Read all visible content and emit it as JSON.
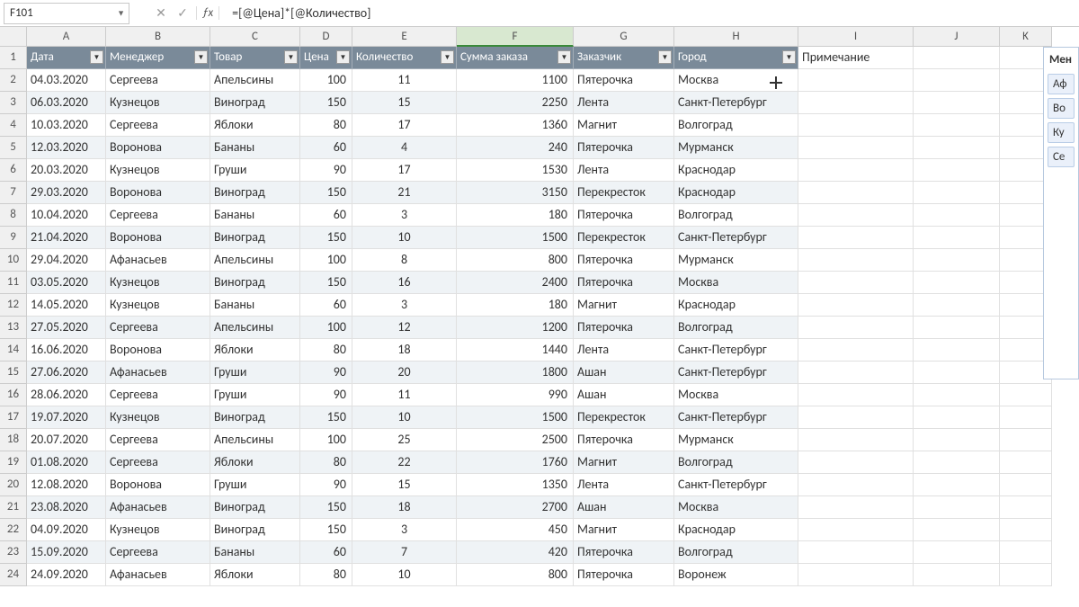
{
  "formula_bar": {
    "cell_ref": "F101",
    "formula": "=[@Цена]*[@Количество]"
  },
  "cols": [
    "A",
    "B",
    "C",
    "D",
    "E",
    "F",
    "G",
    "H",
    "I",
    "J",
    "K"
  ],
  "headers": {
    "A": "Дата",
    "B": "Менеджер",
    "C": "Товар",
    "D": "Цена",
    "E": "Количество",
    "F": "Сумма заказа",
    "G": "Заказчик",
    "H": "Город",
    "I_label": "Примечание"
  },
  "rows": [
    {
      "n": 2,
      "A": "04.03.2020",
      "B": "Сергеева",
      "C": "Апельсины",
      "D": 100,
      "E": 11,
      "F": 1100,
      "G": "Пятерочка",
      "H": "Москва"
    },
    {
      "n": 3,
      "A": "06.03.2020",
      "B": "Кузнецов",
      "C": "Виноград",
      "D": 150,
      "E": 15,
      "F": 2250,
      "G": "Лента",
      "H": "Санкт-Петербург"
    },
    {
      "n": 4,
      "A": "10.03.2020",
      "B": "Сергеева",
      "C": "Яблоки",
      "D": 80,
      "E": 17,
      "F": 1360,
      "G": "Магнит",
      "H": "Волгоград"
    },
    {
      "n": 5,
      "A": "12.03.2020",
      "B": "Воронова",
      "C": "Бананы",
      "D": 60,
      "E": 4,
      "F": 240,
      "G": "Пятерочка",
      "H": "Мурманск"
    },
    {
      "n": 6,
      "A": "20.03.2020",
      "B": "Кузнецов",
      "C": "Груши",
      "D": 90,
      "E": 17,
      "F": 1530,
      "G": "Лента",
      "H": "Краснодар"
    },
    {
      "n": 7,
      "A": "29.03.2020",
      "B": "Воронова",
      "C": "Виноград",
      "D": 150,
      "E": 21,
      "F": 3150,
      "G": "Перекресток",
      "H": "Краснодар"
    },
    {
      "n": 8,
      "A": "10.04.2020",
      "B": "Сергеева",
      "C": "Бананы",
      "D": 60,
      "E": 3,
      "F": 180,
      "G": "Пятерочка",
      "H": "Волгоград"
    },
    {
      "n": 9,
      "A": "21.04.2020",
      "B": "Воронова",
      "C": "Виноград",
      "D": 150,
      "E": 10,
      "F": 1500,
      "G": "Перекресток",
      "H": "Санкт-Петербург"
    },
    {
      "n": 10,
      "A": "29.04.2020",
      "B": "Афанасьев",
      "C": "Апельсины",
      "D": 100,
      "E": 8,
      "F": 800,
      "G": "Пятерочка",
      "H": "Мурманск"
    },
    {
      "n": 11,
      "A": "03.05.2020",
      "B": "Кузнецов",
      "C": "Виноград",
      "D": 150,
      "E": 16,
      "F": 2400,
      "G": "Пятерочка",
      "H": "Москва"
    },
    {
      "n": 12,
      "A": "14.05.2020",
      "B": "Кузнецов",
      "C": "Бананы",
      "D": 60,
      "E": 3,
      "F": 180,
      "G": "Магнит",
      "H": "Краснодар"
    },
    {
      "n": 13,
      "A": "27.05.2020",
      "B": "Сергеева",
      "C": "Апельсины",
      "D": 100,
      "E": 12,
      "F": 1200,
      "G": "Пятерочка",
      "H": "Волгоград"
    },
    {
      "n": 14,
      "A": "16.06.2020",
      "B": "Воронова",
      "C": "Яблоки",
      "D": 80,
      "E": 18,
      "F": 1440,
      "G": "Лента",
      "H": "Санкт-Петербург"
    },
    {
      "n": 15,
      "A": "27.06.2020",
      "B": "Афанасьев",
      "C": "Груши",
      "D": 90,
      "E": 20,
      "F": 1800,
      "G": "Ашан",
      "H": "Санкт-Петербург"
    },
    {
      "n": 16,
      "A": "28.06.2020",
      "B": "Сергеева",
      "C": "Груши",
      "D": 90,
      "E": 11,
      "F": 990,
      "G": "Ашан",
      "H": "Москва"
    },
    {
      "n": 17,
      "A": "19.07.2020",
      "B": "Кузнецов",
      "C": "Виноград",
      "D": 150,
      "E": 10,
      "F": 1500,
      "G": "Перекресток",
      "H": "Санкт-Петербург"
    },
    {
      "n": 18,
      "A": "20.07.2020",
      "B": "Сергеева",
      "C": "Апельсины",
      "D": 100,
      "E": 25,
      "F": 2500,
      "G": "Пятерочка",
      "H": "Мурманск"
    },
    {
      "n": 19,
      "A": "01.08.2020",
      "B": "Сергеева",
      "C": "Яблоки",
      "D": 80,
      "E": 22,
      "F": 1760,
      "G": "Магнит",
      "H": "Волгоград"
    },
    {
      "n": 20,
      "A": "12.08.2020",
      "B": "Воронова",
      "C": "Груши",
      "D": 90,
      "E": 15,
      "F": 1350,
      "G": "Лента",
      "H": "Санкт-Петербург"
    },
    {
      "n": 21,
      "A": "23.08.2020",
      "B": "Афанасьев",
      "C": "Виноград",
      "D": 150,
      "E": 18,
      "F": 2700,
      "G": "Ашан",
      "H": "Москва"
    },
    {
      "n": 22,
      "A": "04.09.2020",
      "B": "Кузнецов",
      "C": "Виноград",
      "D": 150,
      "E": 3,
      "F": 450,
      "G": "Магнит",
      "H": "Краснодар"
    },
    {
      "n": 23,
      "A": "15.09.2020",
      "B": "Сергеева",
      "C": "Бананы",
      "D": 60,
      "E": 7,
      "F": 420,
      "G": "Пятерочка",
      "H": "Волгоград"
    },
    {
      "n": 24,
      "A": "24.09.2020",
      "B": "Афанасьев",
      "C": "Яблоки",
      "D": 80,
      "E": 10,
      "F": 800,
      "G": "Пятерочка",
      "H": "Воронеж"
    }
  ],
  "slicer": {
    "title": "Мен",
    "items": [
      "Аф",
      "Во",
      "Ку",
      "Се"
    ]
  }
}
